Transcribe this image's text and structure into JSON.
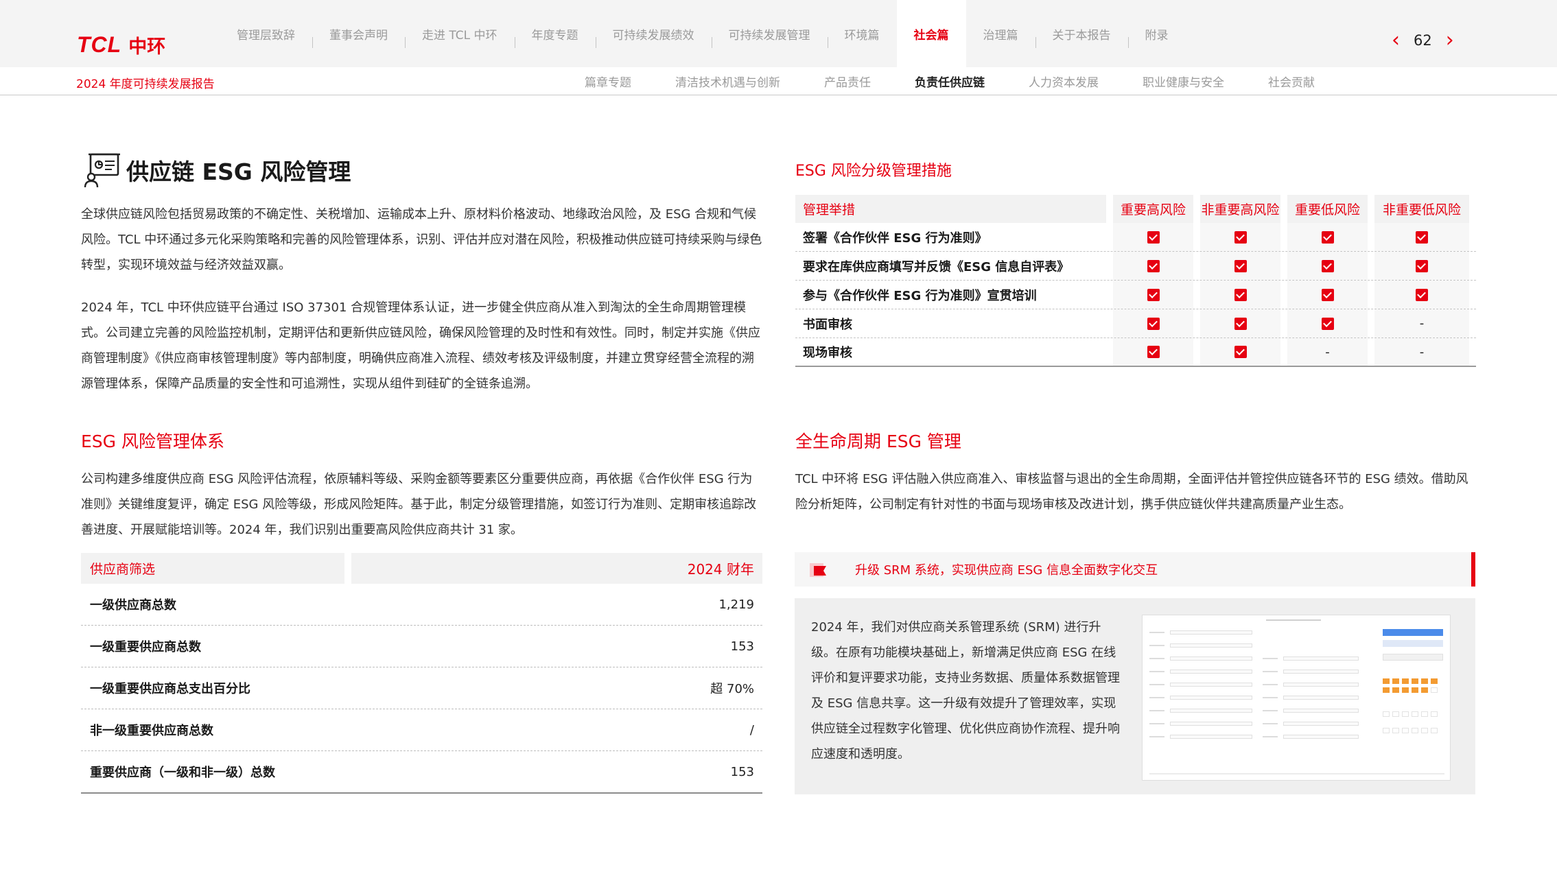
{
  "header": {
    "logo_brand": "TCL",
    "logo_cn": "中环",
    "nav": [
      {
        "label": "管理层致辞",
        "active": false
      },
      {
        "label": "董事会声明",
        "active": false
      },
      {
        "label": "走进 TCL 中环",
        "active": false
      },
      {
        "label": "年度专题",
        "active": false
      },
      {
        "label": "可持续发展绩效",
        "active": false
      },
      {
        "label": "可持续发展管理",
        "active": false
      },
      {
        "label": "环境篇",
        "active": false
      },
      {
        "label": "社会篇",
        "active": true
      },
      {
        "label": "治理篇",
        "active": false
      },
      {
        "label": "关于本报告",
        "active": false
      },
      {
        "label": "附录",
        "active": false
      }
    ],
    "page_number": "62",
    "report_title": "2024 年度可持续发展报告",
    "subnav": [
      {
        "label": "篇章专题",
        "active": false
      },
      {
        "label": "清洁技术机遇与创新",
        "active": false
      },
      {
        "label": "产品责任",
        "active": false
      },
      {
        "label": "负责任供应链",
        "active": true
      },
      {
        "label": "人力资本发展",
        "active": false
      },
      {
        "label": "职业健康与安全",
        "active": false
      },
      {
        "label": "社会贡献",
        "active": false
      }
    ]
  },
  "left": {
    "section_title": "供应链 ESG 风险管理",
    "intro_p1": "全球供应链风险包括贸易政策的不确定性、关税增加、运输成本上升、原材料价格波动、地缘政治风险，及 ESG 合规和气候风险。TCL 中环通过多元化采购策略和完善的风险管理体系，识别、评估并应对潜在风险，积极推动供应链可持续采购与绿色转型，实现环境效益与经济效益双赢。",
    "intro_p2": "2024 年，TCL 中环供应链平台通过 ISO 37301 合规管理体系认证，进一步健全供应商从准入到淘汰的全生命周期管理模式。公司建立完善的风险监控机制，定期评估和更新供应链风险，确保风险管理的及时性和有效性。同时，制定并实施《供应商管理制度》《供应商审核管理制度》等内部制度，明确供应商准入流程、绩效考核及评级制度，并建立贯穿经营全流程的溯源管理体系，保障产品质量的安全性和可追溯性，实现从组件到硅矿的全链条追溯。",
    "subtitle": "ESG 风险管理体系",
    "system_p": "公司构建多维度供应商 ESG 风险评估流程，依原辅料等级、采购金额等要素区分重要供应商，再依据《合作伙伴 ESG 行为准则》关键维度复评，确定 ESG 风险等级，形成风险矩阵。基于此，制定分级管理措施，如签订行为准则、定期审核追踪改善进度、开展赋能培训等。2024 年，我们识别出重要高风险供应商共计 31 家。",
    "supplier_table": {
      "header_left": "供应商筛选",
      "header_right": "2024 财年",
      "rows": [
        {
          "label": "一级供应商总数",
          "value": "1,219"
        },
        {
          "label": "一级重要供应商总数",
          "value": "153"
        },
        {
          "label": "一级重要供应商总支出百分比",
          "value": "超 70%"
        },
        {
          "label": "非一级重要供应商总数",
          "value": "/"
        },
        {
          "label": "重要供应商（一级和非一级）总数",
          "value": "153"
        }
      ]
    }
  },
  "right": {
    "measures_title": "ESG 风险分级管理措施",
    "measures_table": {
      "headers": [
        "管理举措",
        "重要高风险",
        "非重要高风险",
        "重要低风险",
        "非重要低风险"
      ],
      "rows": [
        {
          "label": "签署《合作伙伴 ESG 行为准则》",
          "cells": [
            "check",
            "check",
            "check",
            "check"
          ]
        },
        {
          "label": "要求在库供应商填写并反馈《ESG 信息自评表》",
          "cells": [
            "check",
            "check",
            "check",
            "check"
          ]
        },
        {
          "label": "参与《合作伙伴 ESG 行为准则》宣贯培训",
          "cells": [
            "check",
            "check",
            "check",
            "check"
          ]
        },
        {
          "label": "书面审核",
          "cells": [
            "check",
            "check",
            "check",
            "-"
          ]
        },
        {
          "label": "现场审核",
          "cells": [
            "check",
            "check",
            "-",
            "-"
          ]
        }
      ]
    },
    "lifecycle_title": "全生命周期 ESG 管理",
    "lifecycle_p": "TCL 中环将 ESG 评估融入供应商准入、审核监督与退出的全生命周期，全面评估并管控供应链各环节的 ESG 绩效。借助风险分析矩阵，公司制定有针对性的书面与现场审核及改进计划，携手供应链伙伴共建高质量产业生态。",
    "banner_text": "升级 SRM 系统，实现供应商 ESG 信息全面数字化交互",
    "srm_p": "2024 年，我们对供应商关系管理系统 (SRM) 进行升级。在原有功能模块基础上，新增满足供应商 ESG 在线评价和复评要求功能，支持业务数据、质量体系数据管理及 ESG 信息共享。这一升级有效提升了管理效率，实现供应链全过程数字化管理、优化供应商协作流程、提升响应速度和透明度。"
  },
  "colors": {
    "accent": "#e60012",
    "panel": "#f2f2f2",
    "nav_text": "#9a9a9a"
  }
}
